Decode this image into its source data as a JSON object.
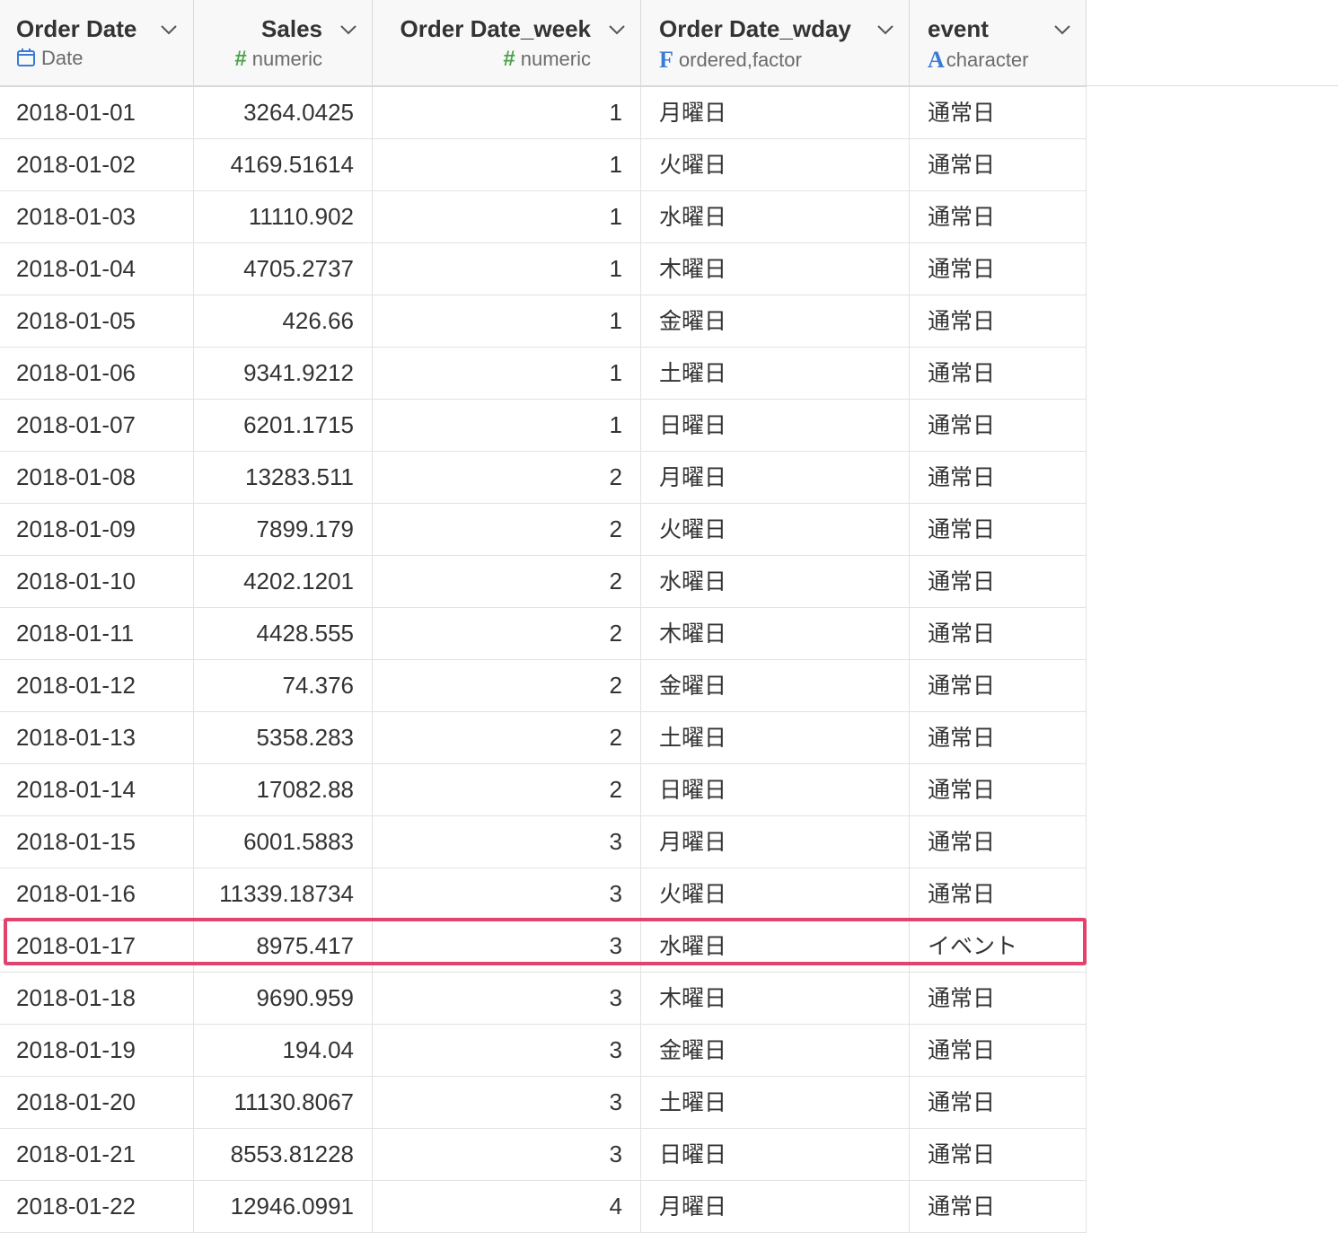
{
  "columns": [
    {
      "name": "Order Date",
      "type": "Date",
      "type_icon": "calendar-icon",
      "align": "left"
    },
    {
      "name": "Sales",
      "type": "numeric",
      "type_icon": "hash-icon",
      "align": "right"
    },
    {
      "name": "Order Date_week",
      "type": "numeric",
      "type_icon": "hash-icon",
      "align": "right"
    },
    {
      "name": "Order Date_wday",
      "type": "ordered,factor",
      "type_icon": "factor-icon",
      "align": "left"
    },
    {
      "name": "event",
      "type": "character",
      "type_icon": "character-icon",
      "align": "left"
    }
  ],
  "type_icon_glyphs": {
    "hash": "#",
    "factor": "F",
    "character": "A"
  },
  "colors": {
    "accent_blue": "#3a7bd5",
    "numeric_green": "#4aa34a",
    "highlight_border": "#e2436c"
  },
  "rows": [
    [
      "2018-01-01",
      "3264.0425",
      "1",
      "月曜日",
      "通常日"
    ],
    [
      "2018-01-02",
      "4169.51614",
      "1",
      "火曜日",
      "通常日"
    ],
    [
      "2018-01-03",
      "11110.902",
      "1",
      "水曜日",
      "通常日"
    ],
    [
      "2018-01-04",
      "4705.2737",
      "1",
      "木曜日",
      "通常日"
    ],
    [
      "2018-01-05",
      "426.66",
      "1",
      "金曜日",
      "通常日"
    ],
    [
      "2018-01-06",
      "9341.9212",
      "1",
      "土曜日",
      "通常日"
    ],
    [
      "2018-01-07",
      "6201.1715",
      "1",
      "日曜日",
      "通常日"
    ],
    [
      "2018-01-08",
      "13283.511",
      "2",
      "月曜日",
      "通常日"
    ],
    [
      "2018-01-09",
      "7899.179",
      "2",
      "火曜日",
      "通常日"
    ],
    [
      "2018-01-10",
      "4202.1201",
      "2",
      "水曜日",
      "通常日"
    ],
    [
      "2018-01-11",
      "4428.555",
      "2",
      "木曜日",
      "通常日"
    ],
    [
      "2018-01-12",
      "74.376",
      "2",
      "金曜日",
      "通常日"
    ],
    [
      "2018-01-13",
      "5358.283",
      "2",
      "土曜日",
      "通常日"
    ],
    [
      "2018-01-14",
      "17082.88",
      "2",
      "日曜日",
      "通常日"
    ],
    [
      "2018-01-15",
      "6001.5883",
      "3",
      "月曜日",
      "通常日"
    ],
    [
      "2018-01-16",
      "11339.18734",
      "3",
      "火曜日",
      "通常日"
    ],
    [
      "2018-01-17",
      "8975.417",
      "3",
      "水曜日",
      "イベント"
    ],
    [
      "2018-01-18",
      "9690.959",
      "3",
      "木曜日",
      "通常日"
    ],
    [
      "2018-01-19",
      "194.04",
      "3",
      "金曜日",
      "通常日"
    ],
    [
      "2018-01-20",
      "11130.8067",
      "3",
      "土曜日",
      "通常日"
    ],
    [
      "2018-01-21",
      "8553.81228",
      "3",
      "日曜日",
      "通常日"
    ],
    [
      "2018-01-22",
      "12946.0991",
      "4",
      "月曜日",
      "通常日"
    ]
  ],
  "highlighted_row_index": 16
}
